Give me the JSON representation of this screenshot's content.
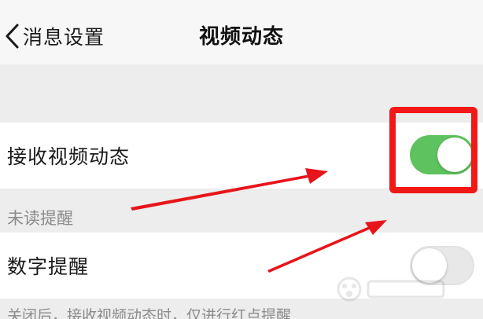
{
  "header": {
    "back_label": "消息设置",
    "title": "视频动态"
  },
  "settings": {
    "receive_label": "接收视频动态",
    "receive_on": true,
    "unread_section": "未读提醒",
    "number_label": "数字提醒",
    "number_on": false,
    "footer_note": "关闭后，接收视频动态时，仅进行红点提醒"
  },
  "colors": {
    "switch_on": "#5ec25f",
    "highlight": "#f21818",
    "annotation_arrow": "#e8141b"
  },
  "icons": {
    "back": "chevron-left-icon"
  }
}
